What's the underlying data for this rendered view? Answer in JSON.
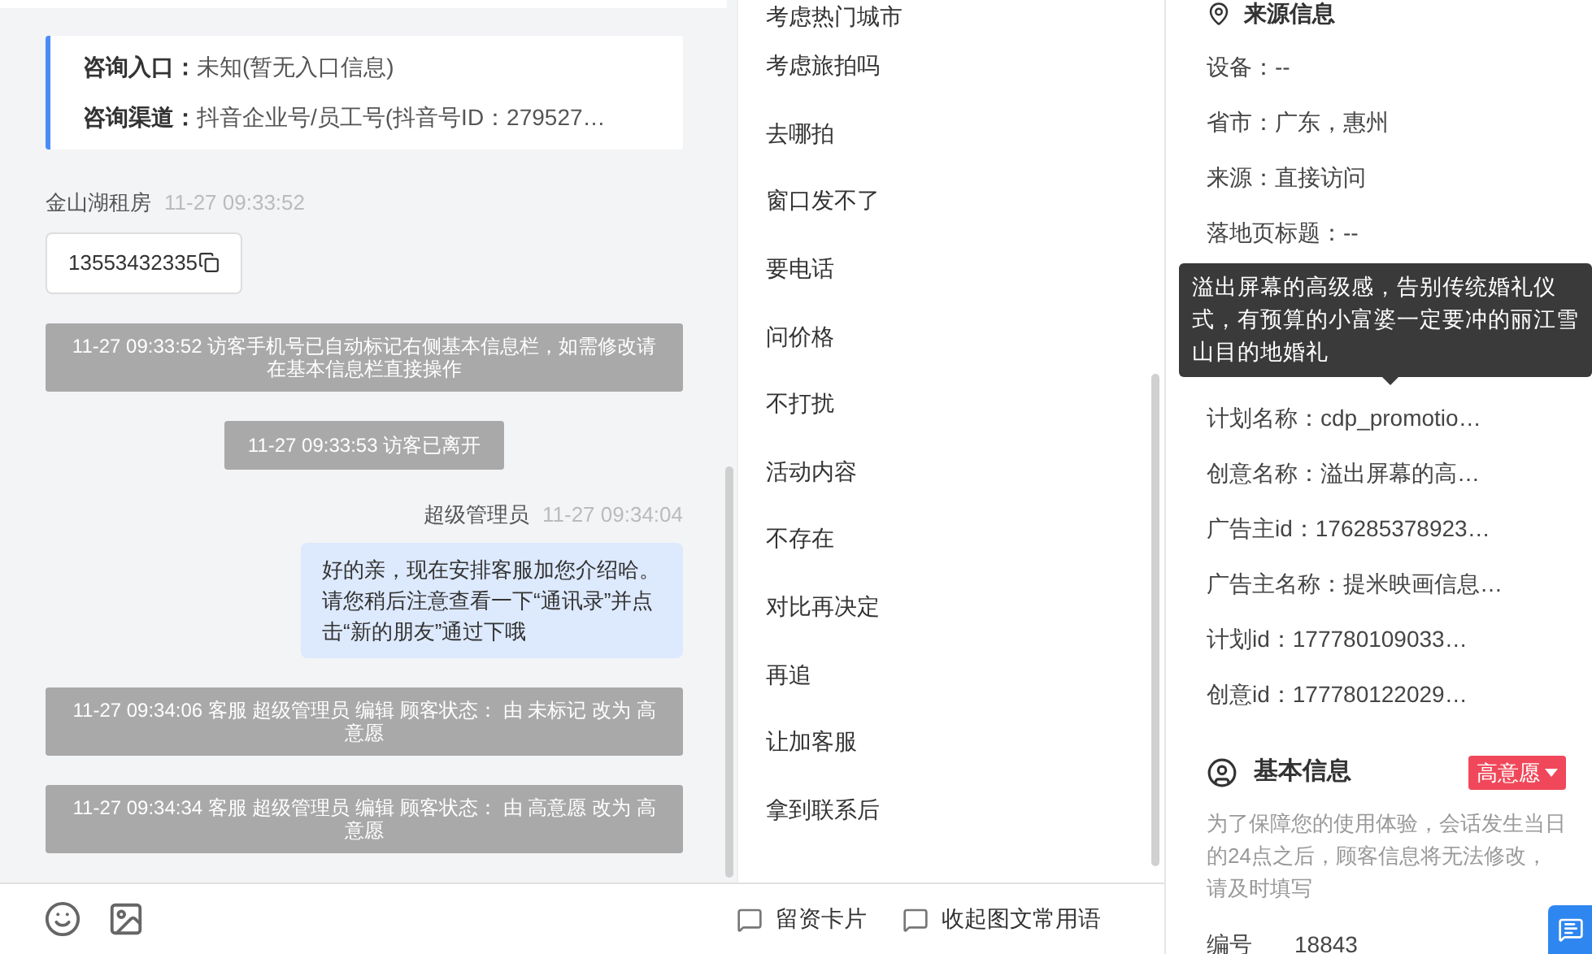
{
  "consult_card": {
    "rows": [
      {
        "label": "咨询入口：",
        "value": "未知(暂无入口信息)"
      },
      {
        "label": "咨询渠道：",
        "value": "抖音企业号/员工号(抖音号ID：279527…"
      }
    ]
  },
  "messages": [
    {
      "kind": "visitor",
      "sender": "金山湖租房",
      "time": "11-27 09:33:52",
      "text": "13553432335"
    },
    {
      "kind": "system",
      "text": "11-27 09:33:52 访客手机号已自动标记右侧基本信息栏，如需修改请在基本信息栏直接操作"
    },
    {
      "kind": "notice",
      "text": "11-27 09:33:53 访客已离开"
    },
    {
      "kind": "agent",
      "sender": "超级管理员",
      "time": "11-27 09:34:04",
      "text": "好的亲，现在安排客服加您介绍哈。请您稍后注意查看一下“通讯录”并点击“新的朋友”通过下哦"
    },
    {
      "kind": "system",
      "text": "11-27 09:34:06 客服 超级管理员 编辑 顾客状态： 由 未标记 改为 高意愿"
    },
    {
      "kind": "system",
      "text": "11-27 09:34:34 客服 超级管理员 编辑 顾客状态： 由 高意愿 改为 高意愿"
    }
  ],
  "quick_replies": [
    "考虑热门城市",
    "考虑旅拍吗",
    "去哪拍",
    "窗口发不了",
    "要电话",
    "问价格",
    "不打扰",
    "活动内容",
    "不存在",
    "对比再决定",
    "再追",
    "让加客服",
    "拿到联系后"
  ],
  "bottom_tools": [
    "留资卡片",
    "收起图文常用语"
  ],
  "source_info": {
    "title": "来源信息",
    "fields_above": [
      "设备：--",
      "省市：广东，惠州",
      "来源：直接访问",
      "落地页标题：--"
    ],
    "tooltip": {
      "text": "溢出屏幕的高级感，告别传统婚礼仪式，有预算的小富婆一定要冲的丽江雪山目的地婚礼"
    },
    "fields_below": [
      "计划名称：cdp_promotio…",
      "创意名称：溢出屏幕的高…",
      "广告主id：176285378923…",
      "广告主名称：提米映画信息…",
      "计划id：177780109033…",
      "创意id：177780122029…"
    ]
  },
  "basic_info": {
    "title": "基本信息",
    "intent_badge": "高意愿",
    "note": "为了保障您的使用体验，会话发生当日的24点之后，顾客信息将无法修改，请及时填写",
    "fields": [
      {
        "label": "编号",
        "value": "18843"
      }
    ]
  }
}
